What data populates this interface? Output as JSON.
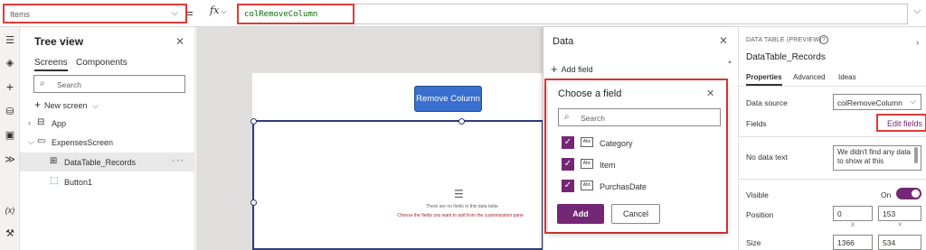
{
  "formula_bar": {
    "property_value": "Items",
    "equals": "=",
    "fx_label": "fx",
    "formula": "colRemoveColumn"
  },
  "rail": {
    "icons": [
      "menu-icon",
      "layers-icon",
      "insert-icon",
      "data-icon",
      "media-icon",
      "power-automate-icon",
      "variables-icon",
      "tools-icon",
      "search-icon"
    ]
  },
  "tree": {
    "title": "Tree view",
    "tabs": {
      "screens": "Screens",
      "components": "Components"
    },
    "search_placeholder": "Search",
    "new_screen": "New screen",
    "nodes": {
      "app": "App",
      "screen": "ExpensesScreen",
      "records": "DataTable_Records",
      "button": "Button1"
    }
  },
  "canvas": {
    "button_label": "Remove Column",
    "empty_line1": "There are no fields in this data table",
    "empty_line2": "Choose the fields you want to add from the customization pane"
  },
  "data_pane": {
    "title": "Data",
    "add_field": "Add field"
  },
  "choose_field": {
    "title": "Choose a field",
    "search_placeholder": "Search",
    "fields": [
      {
        "name": "Category",
        "type_badge": "Abc",
        "checked": true
      },
      {
        "name": "Item",
        "type_badge": "Abc",
        "checked": true
      },
      {
        "name": "PurchasDate",
        "type_badge": "Abc",
        "checked": true
      }
    ],
    "add_label": "Add",
    "cancel_label": "Cancel"
  },
  "properties": {
    "control_type": "DATA TABLE (PREVIEW)",
    "help": "?",
    "control_name": "DataTable_Records",
    "tabs": {
      "properties": "Properties",
      "advanced": "Advanced",
      "ideas": "Ideas"
    },
    "data_source_label": "Data source",
    "data_source_value": "colRemoveColumn",
    "fields_label": "Fields",
    "edit_fields": "Edit fields",
    "no_data_label": "No data text",
    "no_data_value": "We didn't find any data to show at this",
    "visible_label": "Visible",
    "visible_state": "On",
    "visible": true,
    "position_label": "Position",
    "position_x": "0",
    "position_y": "153",
    "x_sub": "X",
    "y_sub": "Y",
    "size_label": "Size",
    "size_w": "1366",
    "size_h": "534"
  },
  "colors": {
    "accent": "#742774",
    "button": "#3a6fd0",
    "highlight": "#e03a3a"
  }
}
